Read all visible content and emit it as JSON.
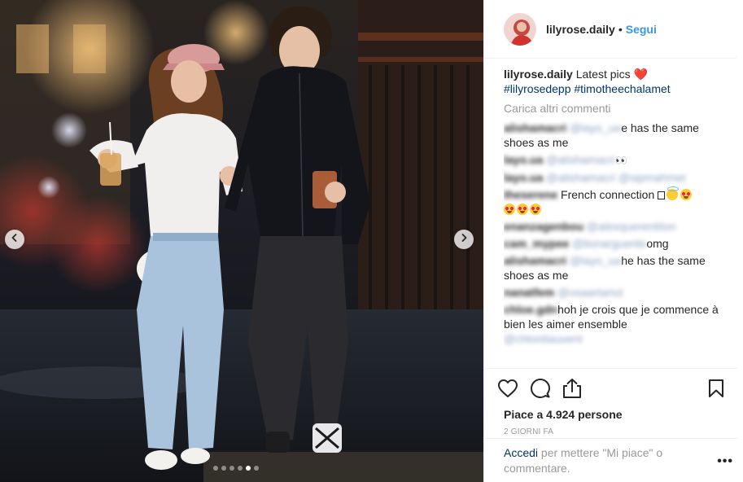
{
  "post": {
    "username": "lilyrose.daily",
    "separator": "•",
    "follow_label": "Segui",
    "caption": {
      "username": "lilyrose.daily",
      "text": "Latest pics",
      "heart": "❤️",
      "hashtags": "#lilyrosedepp #timotheechalamet"
    },
    "load_more_label": "Carica altri commenti",
    "comments": [
      {
        "user": "alishamacri",
        "mention": "@layo_ua",
        "text_pre": "",
        "text": "e has the same shoes as me"
      },
      {
        "user": "layo.ua",
        "mention": "@alishamacri",
        "text": "👀"
      },
      {
        "user": "layo.ua",
        "mention": "@alishamacri @sipmahmet",
        "text": ""
      },
      {
        "user": "theserene",
        "mention": "",
        "text": "French connection"
      },
      {
        "user": "enanzagenbou",
        "mention": "@alexquerentiton",
        "text": ""
      },
      {
        "user": "cam_mypee",
        "mention": "@lionarguerite",
        "text": "omg"
      },
      {
        "user": "alishamacri",
        "mention": "@layo_ua",
        "text": "he has the same shoes as me"
      },
      {
        "user": "nanatfem",
        "mention": "@osaartariut",
        "text": ""
      },
      {
        "user": "chloe.gdn",
        "mention": "",
        "text": "hoh je crois que je commence à bien les aimer ensemble"
      },
      {
        "user": "",
        "mention": "@chlonitauvent",
        "text": ""
      }
    ],
    "likes_label": "Piace a 4.924 persone",
    "time_label": "2 GIORNI FA",
    "add_comment": {
      "login_label": "Accedi",
      "text": "per mettere \"Mi piace\" o commentare."
    },
    "more_label": "•••"
  },
  "carousel": {
    "total_slides": 6,
    "active_slide": 5
  },
  "icons": {
    "prev": "chevron-left-icon",
    "next": "chevron-right-icon",
    "like": "heart-outline-icon",
    "comment": "speech-bubble-icon",
    "share": "share-icon",
    "save": "bookmark-icon"
  },
  "colors": {
    "link": "#3897f0",
    "hashtag": "#003569",
    "muted": "#999999",
    "text": "#262626"
  }
}
